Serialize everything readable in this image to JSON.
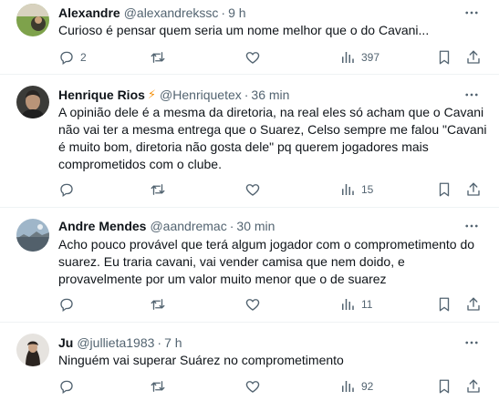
{
  "tweets": [
    {
      "name": "Alexandre",
      "handle": "@alexandrekssc",
      "time": "9 h",
      "verified": "",
      "text": "Curioso é pensar quem seria um nome melhor que o do Cavani...",
      "replies": "2",
      "views": "397",
      "avatar_icon": "avatar-alexandre"
    },
    {
      "name": "Henrique Rios",
      "handle": "@Henriquetex",
      "time": "36 min",
      "verified": "⚡",
      "text": "A opinião dele é a mesma da diretoria, na real eles só acham que o Cavani\nnão vai ter a mesma entrega que o Suarez, Celso sempre me falou \"Cavani\né muito bom, diretoria não gosta dele\" pq querem jogadores mais\ncomprometidos com o clube.",
      "replies": "",
      "views": "15",
      "avatar_icon": "avatar-henrique"
    },
    {
      "name": "Andre Mendes",
      "handle": "@aandremac",
      "time": "30 min",
      "verified": "",
      "text": "Acho pouco provável que terá algum jogador com o comprometimento do\nsuarez. Eu traria cavani, vai vender camisa que nem doido, e\nprovavelmente por um valor muito menor que o de suarez",
      "replies": "",
      "views": "11",
      "avatar_icon": "avatar-andre"
    },
    {
      "name": "Ju",
      "handle": "@jullieta1983",
      "time": "7 h",
      "verified": "",
      "text": "Ninguém vai superar Suárez no comprometimento",
      "replies": "",
      "views": "92",
      "avatar_icon": "avatar-ju"
    }
  ],
  "separator": "·",
  "colors": {
    "text": "#0f1419",
    "muted": "#536471",
    "border": "#eff3f4",
    "verified": "#f4900c"
  },
  "icons": [
    "reply-icon",
    "retweet-icon",
    "like-icon",
    "views-icon",
    "bookmark-icon",
    "share-icon",
    "more-icon"
  ]
}
